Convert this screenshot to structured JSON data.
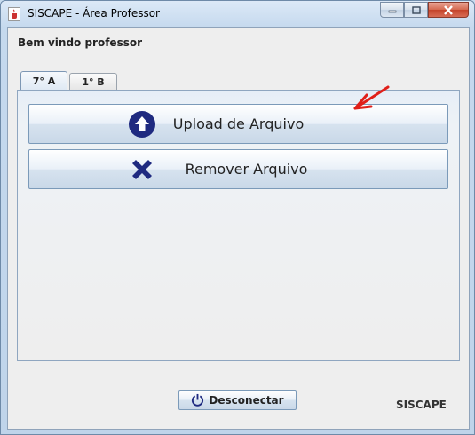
{
  "window": {
    "title": "SISCAPE - Área Professor",
    "app_icon": "java-cup-icon",
    "controls": [
      "minimize-icon",
      "maximize-icon",
      "close-icon"
    ]
  },
  "header": {
    "welcome": "Bem vindo professor"
  },
  "tabs": [
    {
      "label": "7° A",
      "selected": true
    },
    {
      "label": "1° B",
      "selected": false
    }
  ],
  "actions": {
    "upload": {
      "label": "Upload de Arquivo",
      "icon": "upload-arrow-icon"
    },
    "remove": {
      "label": "Remover Arquivo",
      "icon": "x-mark-icon"
    }
  },
  "footer": {
    "disconnect": {
      "label": "Desconectar",
      "icon": "power-icon"
    },
    "brand": "SISCAPE"
  },
  "colors": {
    "icon_navy": "#1f2a80",
    "annotation_red": "#e0201a"
  }
}
